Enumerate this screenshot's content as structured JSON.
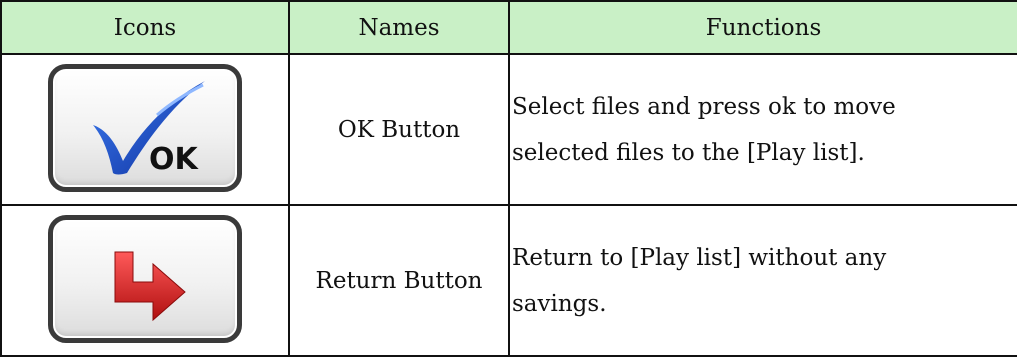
{
  "table": {
    "headers": {
      "icons": "Icons",
      "names": "Names",
      "functions": "Functions"
    },
    "rows": [
      {
        "icon": "ok-check-icon",
        "icon_text": "OK",
        "name": "OK Button",
        "function_lines": [
          "Select files and press ok to move",
          "selected files to the [Play list]."
        ]
      },
      {
        "icon": "return-arrow-icon",
        "name": "Return Button",
        "function_lines": [
          "Return to [Play list] without any",
          "savings."
        ]
      }
    ]
  },
  "colors": {
    "header_bg": "#c9f0c6",
    "check_blue": "#1a49c8",
    "arrow_red": "#d81e1e"
  }
}
